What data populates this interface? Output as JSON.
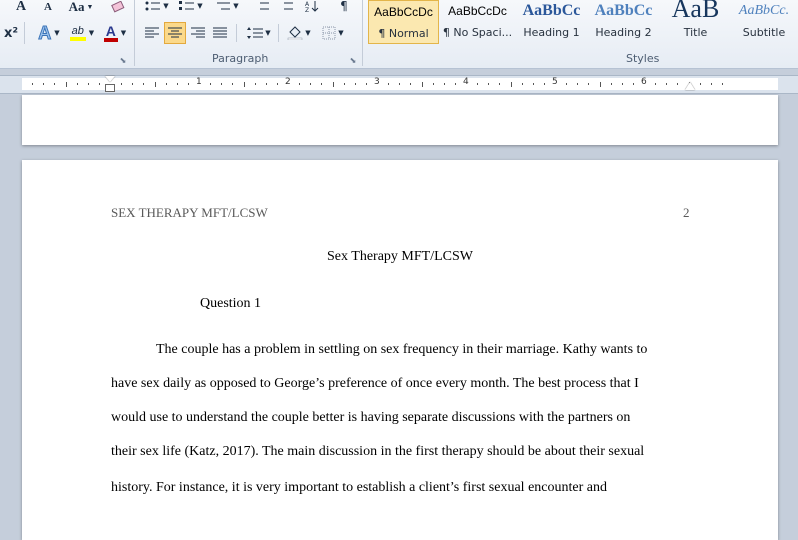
{
  "ribbon": {
    "font_group": {
      "font_a_grow": "A",
      "font_a_shrink": "A",
      "change_case": "Aa",
      "superscript": "x²",
      "text_effects": "A",
      "highlight": "ab",
      "font_color": "A"
    },
    "paragraph_group": {
      "label": "Paragraph"
    },
    "styles_group": {
      "label": "Styles"
    },
    "styles": [
      {
        "sample": "AaBbCcDc",
        "name": "¶ Normal"
      },
      {
        "sample": "AaBbCcDc",
        "name": "¶ No Spaci..."
      },
      {
        "sample": "AaBbCc",
        "name": "Heading 1"
      },
      {
        "sample": "AaBbCc",
        "name": "Heading 2"
      },
      {
        "sample": "AaB",
        "name": "Title"
      },
      {
        "sample": "AaBbCc.",
        "name": "Subtitle"
      }
    ]
  },
  "ruler": {
    "numbers": [
      "1",
      "2",
      "3",
      "4",
      "5",
      "6"
    ]
  },
  "colors": {
    "highlight": "#ffff00",
    "font_color": "#c00000",
    "heading_blue": "#2b579a"
  },
  "document": {
    "running_head": "SEX THERAPY MFT/LCSW",
    "page_number": "2",
    "title": "Sex Therapy MFT/LCSW",
    "section_heading": "Question 1",
    "body_lines": [
      "The couple has a problem in settling on sex frequency in their marriage. Kathy wants to",
      "have sex daily as opposed to George’s preference of once every month. The best process that I",
      "would use to understand the couple better is having separate discussions with the partners on",
      "their sex life (Katz, 2017). The main discussion in the first therapy should be about their sexual",
      "history. For instance, it is very important to establish a client’s first sexual encounter and"
    ]
  }
}
